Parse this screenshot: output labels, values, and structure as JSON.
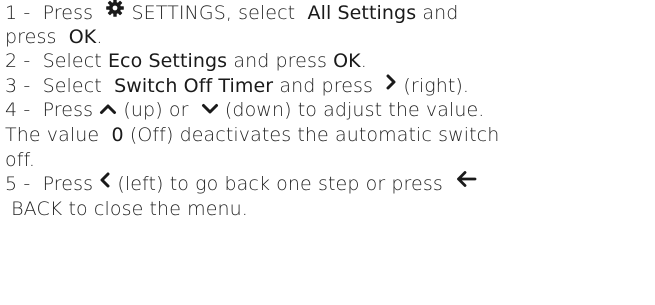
{
  "steps": [
    {
      "num": "1 -",
      "t1": "Press",
      "icon1": "gear-icon",
      "t2": "SETTINGS, select",
      "b1": "All Settings",
      "t3": "and",
      "t4": "press",
      "b2": "OK",
      "t5": "."
    },
    {
      "num": "2 -",
      "t1": "Select",
      "b1": "Eco Settings",
      "t2": "and press",
      "b2": "OK",
      "t3": "."
    },
    {
      "num": "3 -",
      "t1": "Select",
      "b1": "Switch Off Timer",
      "t2": "and press",
      "icon1": "chevron-right-icon",
      "t3": "(right)."
    },
    {
      "num": "4 -",
      "t1": "Press",
      "icon1": "chevron-up-icon",
      "t2": "(up) or",
      "icon2": "chevron-down-icon",
      "t3": "(down) to adjust the value.",
      "t4": "The value",
      "b1": "0",
      "t5": "(Off) deactivates the automatic switch",
      "t6": "off."
    },
    {
      "num": "5 -",
      "t1": "Press",
      "icon1": "chevron-left-icon",
      "t2": "(left) to go back one step or press",
      "icon2": "back-arrow-icon",
      "t3": "BACK to close the menu."
    }
  ],
  "colors": {
    "text": "#222222",
    "icon": "#1a1a1a"
  }
}
